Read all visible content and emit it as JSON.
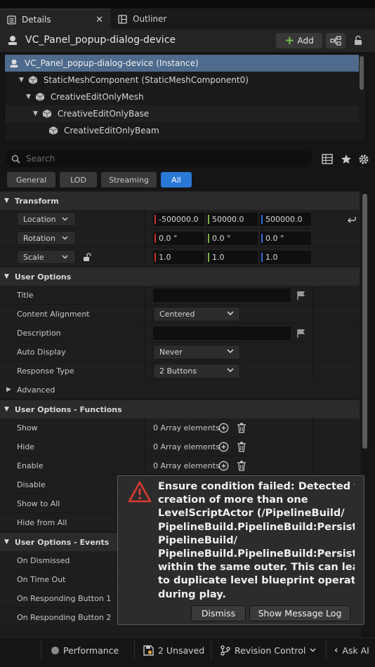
{
  "tabs": {
    "details": "Details",
    "outliner": "Outliner"
  },
  "header": {
    "actor_name": "VC_Panel_popup-dialog-device",
    "add_label": "Add"
  },
  "tree": [
    "VC_Panel_popup-dialog-device (Instance)",
    "StaticMeshComponent (StaticMeshComponent0)",
    "CreativeEditOnlyMesh",
    "CreativeEditOnlyBase",
    "CreativeEditOnlyBeam"
  ],
  "search": {
    "placeholder": "Search"
  },
  "filters": [
    "General",
    "LOD",
    "Streaming",
    "All"
  ],
  "filter_active": "All",
  "transform": {
    "category": "Transform",
    "location": {
      "label": "Location",
      "x": "-500000.0",
      "y": "50000.0",
      "z": "500000.0"
    },
    "rotation": {
      "label": "Rotation",
      "x": "0.0 °",
      "y": "0.0 °",
      "z": "0.0 °"
    },
    "scale": {
      "label": "Scale",
      "x": "1.0",
      "y": "1.0",
      "z": "1.0"
    }
  },
  "user_options": {
    "category": "User Options",
    "title_label": "Title",
    "content_alignment": {
      "label": "Content Alignment",
      "value": "Centered"
    },
    "description_label": "Description",
    "auto_display": {
      "label": "Auto Display",
      "value": "Never"
    },
    "response_type": {
      "label": "Response Type",
      "value": "2 Buttons"
    },
    "advanced_label": "Advanced"
  },
  "functions": {
    "category": "User Options - Functions",
    "array_text": "0 Array elements",
    "rows": [
      "Show",
      "Hide",
      "Enable",
      "Disable",
      "Show to All",
      "Hide from All"
    ]
  },
  "events": {
    "category": "User Options - Events",
    "rows": [
      "On Dismissed",
      "On Time Out",
      "On Responding Button 1",
      "On Responding Button 2"
    ]
  },
  "dialog": {
    "message": "Ensure condition failed: Detected the\ncreation of more than one\nLevelScriptActor (/PipelineBuild/\nPipelineBuild.PipelineBuild:PersistentLevel\nPipelineBuild/\nPipelineBuild.PipelineBuild:PersistentLevel\nwithin the same outer. This can lead\nto duplicate level blueprint operations\nduring play.",
    "dismiss": "Dismiss",
    "show_log": "Show Message Log"
  },
  "status": {
    "performance": "Performance",
    "unsaved": "2 Unsaved",
    "revision": "Revision Control",
    "ask_ai": "Ask AI"
  }
}
